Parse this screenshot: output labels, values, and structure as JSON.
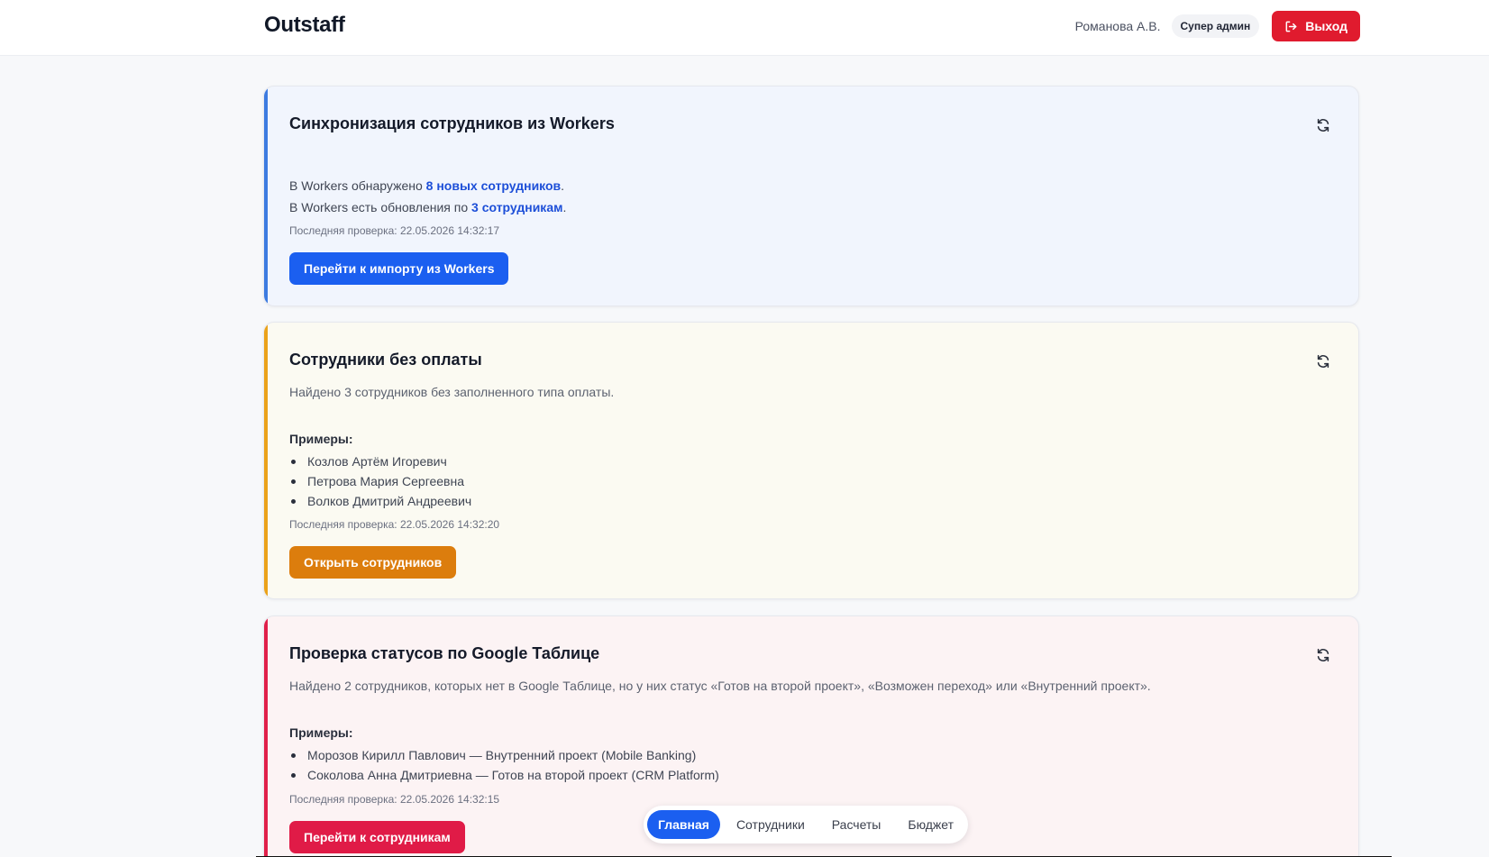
{
  "header": {
    "logo": "Outstaff",
    "user_name": "Романова А.В.",
    "role": "Супер админ",
    "logout_label": "Выход"
  },
  "cards": [
    {
      "title": "Синхронизация сотрудников из Workers",
      "line1_prefix": "В Workers обнаружено ",
      "line1_link": "8 новых сотрудников",
      "line1_suffix": ".",
      "line2_prefix": "В Workers есть обновления по ",
      "line2_link": "3 сотрудникам",
      "line2_suffix": ".",
      "last_check": "Последняя проверка: 22.05.2026 14:32:17",
      "button_label": "Перейти к импорту из Workers",
      "accent": "#3d7be0"
    },
    {
      "title": "Сотрудники без оплаты",
      "description": "Найдено 3 сотрудников без заполненного типа оплаты.",
      "examples_label": "Примеры:",
      "examples": [
        "Козлов Артём Игоревич",
        "Петрова Мария Сергеевна",
        "Волков Дмитрий Андреевич"
      ],
      "last_check": "Последняя проверка: 22.05.2026 14:32:20",
      "button_label": "Открыть сотрудников",
      "accent": "#eba21a"
    },
    {
      "title": "Проверка статусов по Google Таблице",
      "description": "Найдено 2 сотрудников, которых нет в Google Таблице, но у них статус «Готов на второй проект», «Возможен переход» или «Внутренний проект».",
      "examples_label": "Примеры:",
      "examples": [
        "Морозов Кирилл Павлович — Внутренний проект (Mobile Banking)",
        "Соколова Анна Дмитриевна — Готов на второй проект (CRM Platform)"
      ],
      "last_check": "Последняя проверка: 22.05.2026 14:32:15",
      "button_label": "Перейти к сотрудникам",
      "accent": "#e0204a"
    }
  ],
  "nav": {
    "tabs": [
      "Главная",
      "Сотрудники",
      "Расчеты",
      "Бюджет"
    ],
    "active": "Главная"
  }
}
